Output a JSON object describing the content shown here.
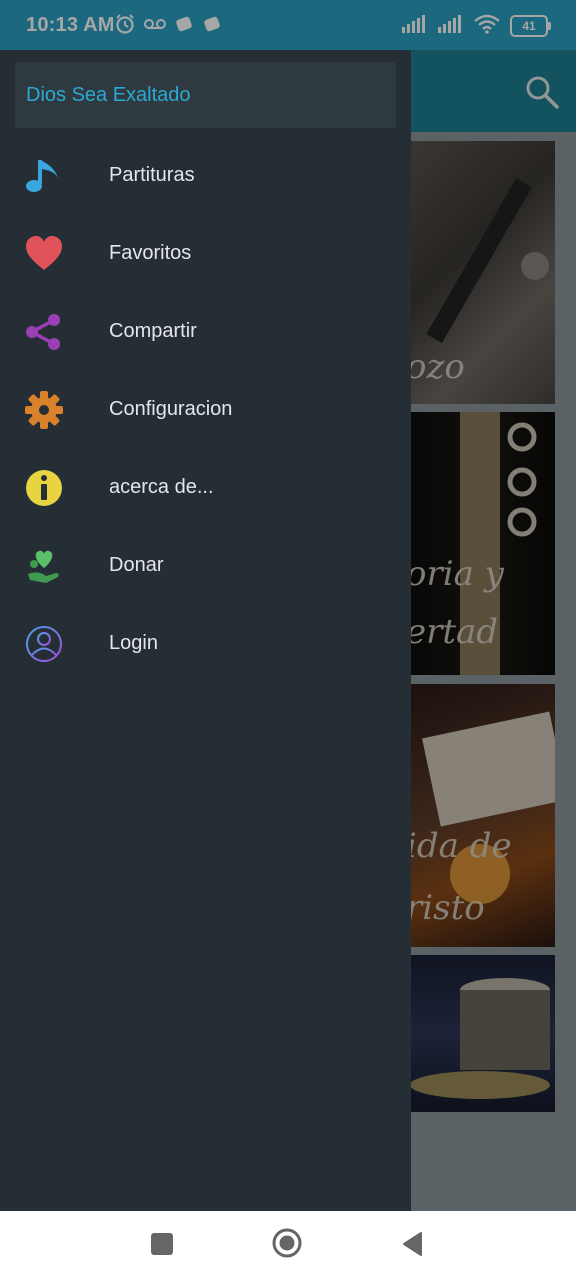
{
  "status_bar": {
    "time": "10:13 AM",
    "battery": "41",
    "icons": [
      "alarm-icon",
      "voicemail-icon",
      "notification-icon",
      "notification-icon",
      "signal-icon",
      "signal-icon",
      "wifi-icon",
      "battery-icon"
    ]
  },
  "drawer": {
    "header_title": "Dios Sea Exaltado",
    "items": [
      {
        "label": "Partituras",
        "icon": "music-note-icon"
      },
      {
        "label": "Favoritos",
        "icon": "heart-icon"
      },
      {
        "label": "Compartir",
        "icon": "share-icon"
      },
      {
        "label": "Configuracion",
        "icon": "gear-icon"
      },
      {
        "label": "acerca de...",
        "icon": "info-icon"
      },
      {
        "label": "Donar",
        "icon": "donate-icon"
      },
      {
        "label": "Login",
        "icon": "user-icon"
      }
    ]
  },
  "background": {
    "cards": [
      {
        "text": "ozo"
      },
      {
        "text": "oria y",
        "text2": "ertad"
      },
      {
        "text": "ida de",
        "text2": "risto"
      },
      {
        "text": ""
      }
    ]
  },
  "colors": {
    "status_bar": "#2aa0c4",
    "drawer_bg": "#262e35",
    "header_title": "#29a9d3"
  }
}
